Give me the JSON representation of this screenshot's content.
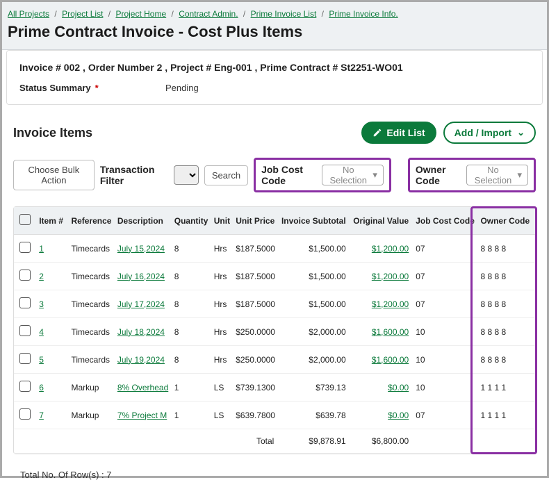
{
  "breadcrumb": [
    "All Projects",
    "Project List",
    "Project Home",
    "Contract Admin.",
    "Prime Invoice List",
    "Prime Invoice Info."
  ],
  "page_title": "Prime Contract Invoice - Cost Plus Items",
  "invoice_meta": "Invoice # 002 , Order Number 2 , Project # Eng-001 , Prime Contract # St2251-WO01",
  "status": {
    "label": "Status Summary",
    "value": "Pending"
  },
  "section": {
    "title": "Invoice Items",
    "edit_btn": "Edit List",
    "add_btn": "Add / Import"
  },
  "toolbar": {
    "bulk": "Choose Bulk Action",
    "txn_filter_label": "Transaction Filter",
    "search": "Search",
    "jcc_label": "Job Cost Code",
    "owner_label": "Owner Code",
    "no_selection": "No Selection"
  },
  "columns": {
    "item": "Item #",
    "reference": "Reference",
    "description": "Description",
    "quantity": "Quantity",
    "unit": "Unit",
    "unit_price": "Unit Price",
    "subtotal": "Invoice Subtotal",
    "original": "Original Value",
    "jcc": "Job Cost Code",
    "owner": "Owner Code"
  },
  "rows": [
    {
      "item": "1",
      "ref": "Timecards",
      "desc": "July 15,2024",
      "qty": "8",
      "unit": "Hrs",
      "price": "$187.5000",
      "sub": "$1,500.00",
      "orig": "$1,200.00",
      "jcc": "07",
      "owner": "8 8 8 8"
    },
    {
      "item": "2",
      "ref": "Timecards",
      "desc": "July 16,2024",
      "qty": "8",
      "unit": "Hrs",
      "price": "$187.5000",
      "sub": "$1,500.00",
      "orig": "$1,200.00",
      "jcc": "07",
      "owner": "8 8 8 8"
    },
    {
      "item": "3",
      "ref": "Timecards",
      "desc": "July 17,2024",
      "qty": "8",
      "unit": "Hrs",
      "price": "$187.5000",
      "sub": "$1,500.00",
      "orig": "$1,200.00",
      "jcc": "07",
      "owner": "8 8 8 8"
    },
    {
      "item": "4",
      "ref": "Timecards",
      "desc": "July 18,2024",
      "qty": "8",
      "unit": "Hrs",
      "price": "$250.0000",
      "sub": "$2,000.00",
      "orig": "$1,600.00",
      "jcc": "10",
      "owner": "8 8 8 8"
    },
    {
      "item": "5",
      "ref": "Timecards",
      "desc": "July 19,2024",
      "qty": "8",
      "unit": "Hrs",
      "price": "$250.0000",
      "sub": "$2,000.00",
      "orig": "$1,600.00",
      "jcc": "10",
      "owner": "8 8 8 8"
    },
    {
      "item": "6",
      "ref": "Markup",
      "desc": "8% Overhead",
      "qty": "1",
      "unit": "LS",
      "price": "$739.1300",
      "sub": "$739.13",
      "orig": "$0.00",
      "jcc": "10",
      "owner": "1 1 1 1"
    },
    {
      "item": "7",
      "ref": "Markup",
      "desc": "7% Project M",
      "qty": "1",
      "unit": "LS",
      "price": "$639.7800",
      "sub": "$639.78",
      "orig": "$0.00",
      "jcc": "07",
      "owner": "1 1 1 1"
    }
  ],
  "totals": {
    "label": "Total",
    "sub": "$9,878.91",
    "orig": "$6,800.00"
  },
  "footer": "Total No. Of Row(s) : 7"
}
